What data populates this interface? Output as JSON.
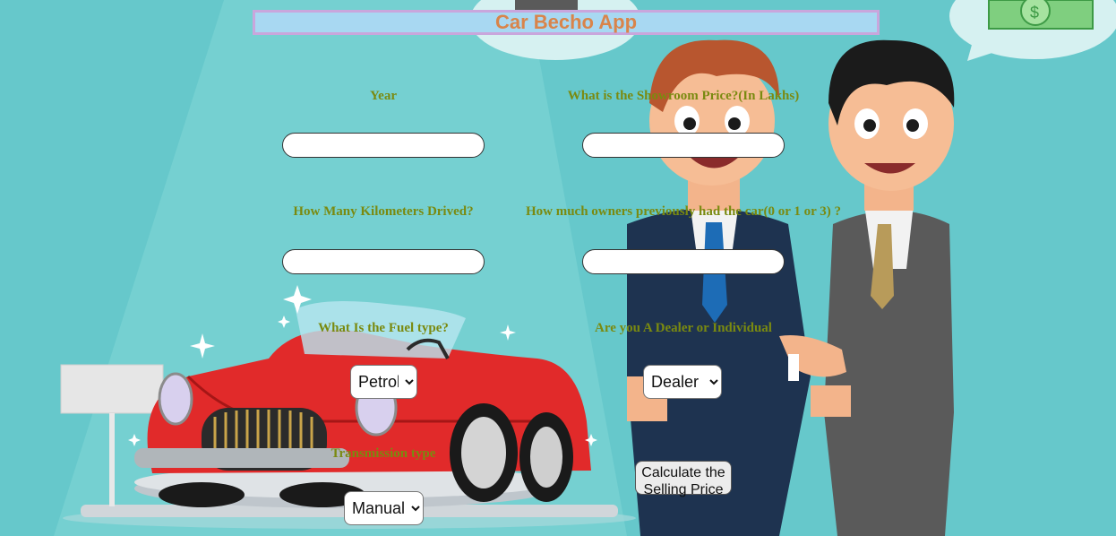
{
  "app": {
    "title": "Car Becho App"
  },
  "form": {
    "year_label": "Year",
    "showroom_price_label": "What is the Showroom Price?(In Lakhs)",
    "kms_driven_label": "How Many Kilometers Drived?",
    "owners_label": "How much owners previously had the car(0 or 1 or 3) ?",
    "fuel_type_label": "What Is the Fuel type?",
    "seller_type_label": "Are you A Dealer or Individual",
    "transmission_label": "Transmission type",
    "year_value": "",
    "showroom_price_value": "",
    "kms_driven_value": "",
    "owners_value": "",
    "fuel_type_selected": "Petrol",
    "seller_type_selected": "Dealer",
    "transmission_selected": "Manual Car",
    "calculate_button": "Calculate the Selling Price"
  },
  "illustration": {
    "icons": [
      "dollar-bill-icon",
      "sparkle-icon",
      "car-icon",
      "businessman-icon",
      "handshake-icon"
    ],
    "car_color": "#e12a2a",
    "background_color": "#66c8cb",
    "text_accent": "#7a8a10",
    "title_color": "#d9844a"
  }
}
